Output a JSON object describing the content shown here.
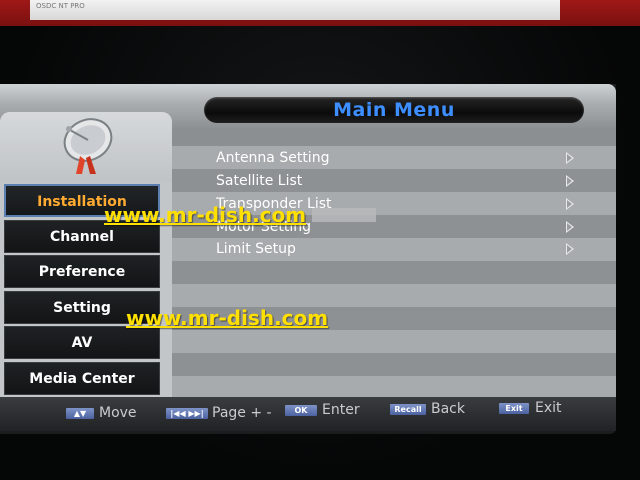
{
  "photo_top": {
    "sticker_text": "OSDC NT PRO"
  },
  "header": {
    "title": "Main Menu"
  },
  "sidebar": {
    "logo_icon": "satellite-dish-icon",
    "items": [
      {
        "label": "Installation",
        "active": true
      },
      {
        "label": "Channel"
      },
      {
        "label": "Preference"
      },
      {
        "label": "Setting"
      },
      {
        "label": "AV"
      },
      {
        "label": "Media Center"
      }
    ]
  },
  "submenu": {
    "items": [
      {
        "label": "Antenna Setting"
      },
      {
        "label": "Satellite List"
      },
      {
        "label": "Transponder List"
      },
      {
        "label": "Motor Setting"
      },
      {
        "label": "Limit Setup"
      }
    ],
    "arrow_icon": "chevron-right-icon"
  },
  "watermarks": [
    "www.mr-dish.com",
    "www.mr-dish.com"
  ],
  "help_bar": {
    "items": [
      {
        "key": "▲▼",
        "label": "Move"
      },
      {
        "key": "|◀◀ ▶▶|",
        "label": "Page + -"
      },
      {
        "key": "OK",
        "label": "Enter"
      },
      {
        "key": "Recall",
        "label": "Back"
      },
      {
        "key": "Exit",
        "label": "Exit"
      }
    ]
  },
  "colors": {
    "title_blue": "#3d8fff",
    "active_item_orange": "#ffaa30",
    "watermark_yellow": "#ffe000"
  }
}
